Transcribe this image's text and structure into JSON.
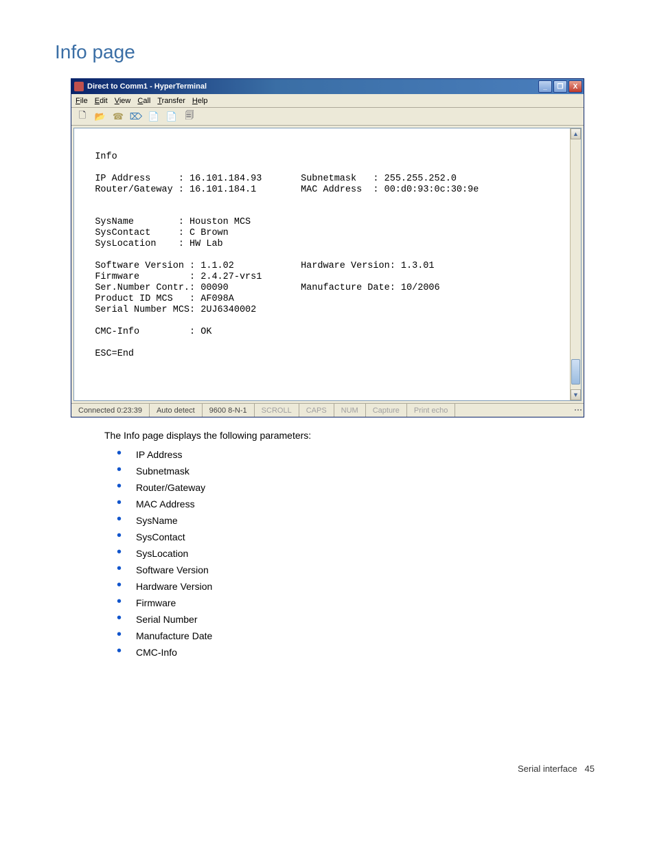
{
  "heading": "Info page",
  "window": {
    "title": "Direct to Comm1 - HyperTerminal",
    "menu": {
      "file": "File",
      "edit": "Edit",
      "view": "View",
      "call": "Call",
      "transfer": "Transfer",
      "help": "Help"
    },
    "win_btns": {
      "min": "_",
      "max": "❐",
      "close": "X"
    },
    "scrollbar": {
      "up": "▲",
      "down": "▼"
    }
  },
  "terminal": {
    "title": "Info",
    "fields": {
      "ip_address_label": "IP Address",
      "ip_address": "16.101.184.93",
      "subnet_label": "Subnetmask",
      "subnet": "255.255.252.0",
      "gateway_label": "Router/Gateway",
      "gateway": "16.101.184.1",
      "mac_label": "MAC Address",
      "mac": "00:d0:93:0c:30:9e",
      "sysname_label": "SysName",
      "sysname": "Houston MCS",
      "syscontact_label": "SysContact",
      "syscontact": "C Brown",
      "syslocation_label": "SysLocation",
      "syslocation": "HW Lab",
      "swver_label": "Software Version",
      "swver": "1.1.02",
      "hwver_label": "Hardware Version",
      "hwver": "1.3.01",
      "fw_label": "Firmware",
      "fw": "2.4.27-vrs1",
      "sernum_label": "Ser.Number Contr.",
      "sernum": "00090",
      "mfg_label": "Manufacture Date",
      "mfg": "10/2006",
      "pid_label": "Product ID MCS",
      "pid": "AF098A",
      "snmcs_label": "Serial Number MCS",
      "snmcs": "2UJ6340002",
      "cmc_label": "CMC-Info",
      "cmc": "OK",
      "esc": "ESC=End"
    }
  },
  "status": {
    "connected": "Connected 0:23:39",
    "detect": "Auto detect",
    "baud": "9600 8-N-1",
    "scroll": "SCROLL",
    "caps": "CAPS",
    "num": "NUM",
    "capture": "Capture",
    "echo": "Print echo"
  },
  "caption": "The Info page displays the following parameters:",
  "params": [
    "IP Address",
    "Subnetmask",
    "Router/Gateway",
    "MAC Address",
    "SysName",
    "SysContact",
    "SysLocation",
    "Software Version",
    "Hardware Version",
    "Firmware",
    "Serial Number",
    "Manufacture Date",
    "CMC-Info"
  ],
  "footer": {
    "section": "Serial interface",
    "page": "45"
  }
}
